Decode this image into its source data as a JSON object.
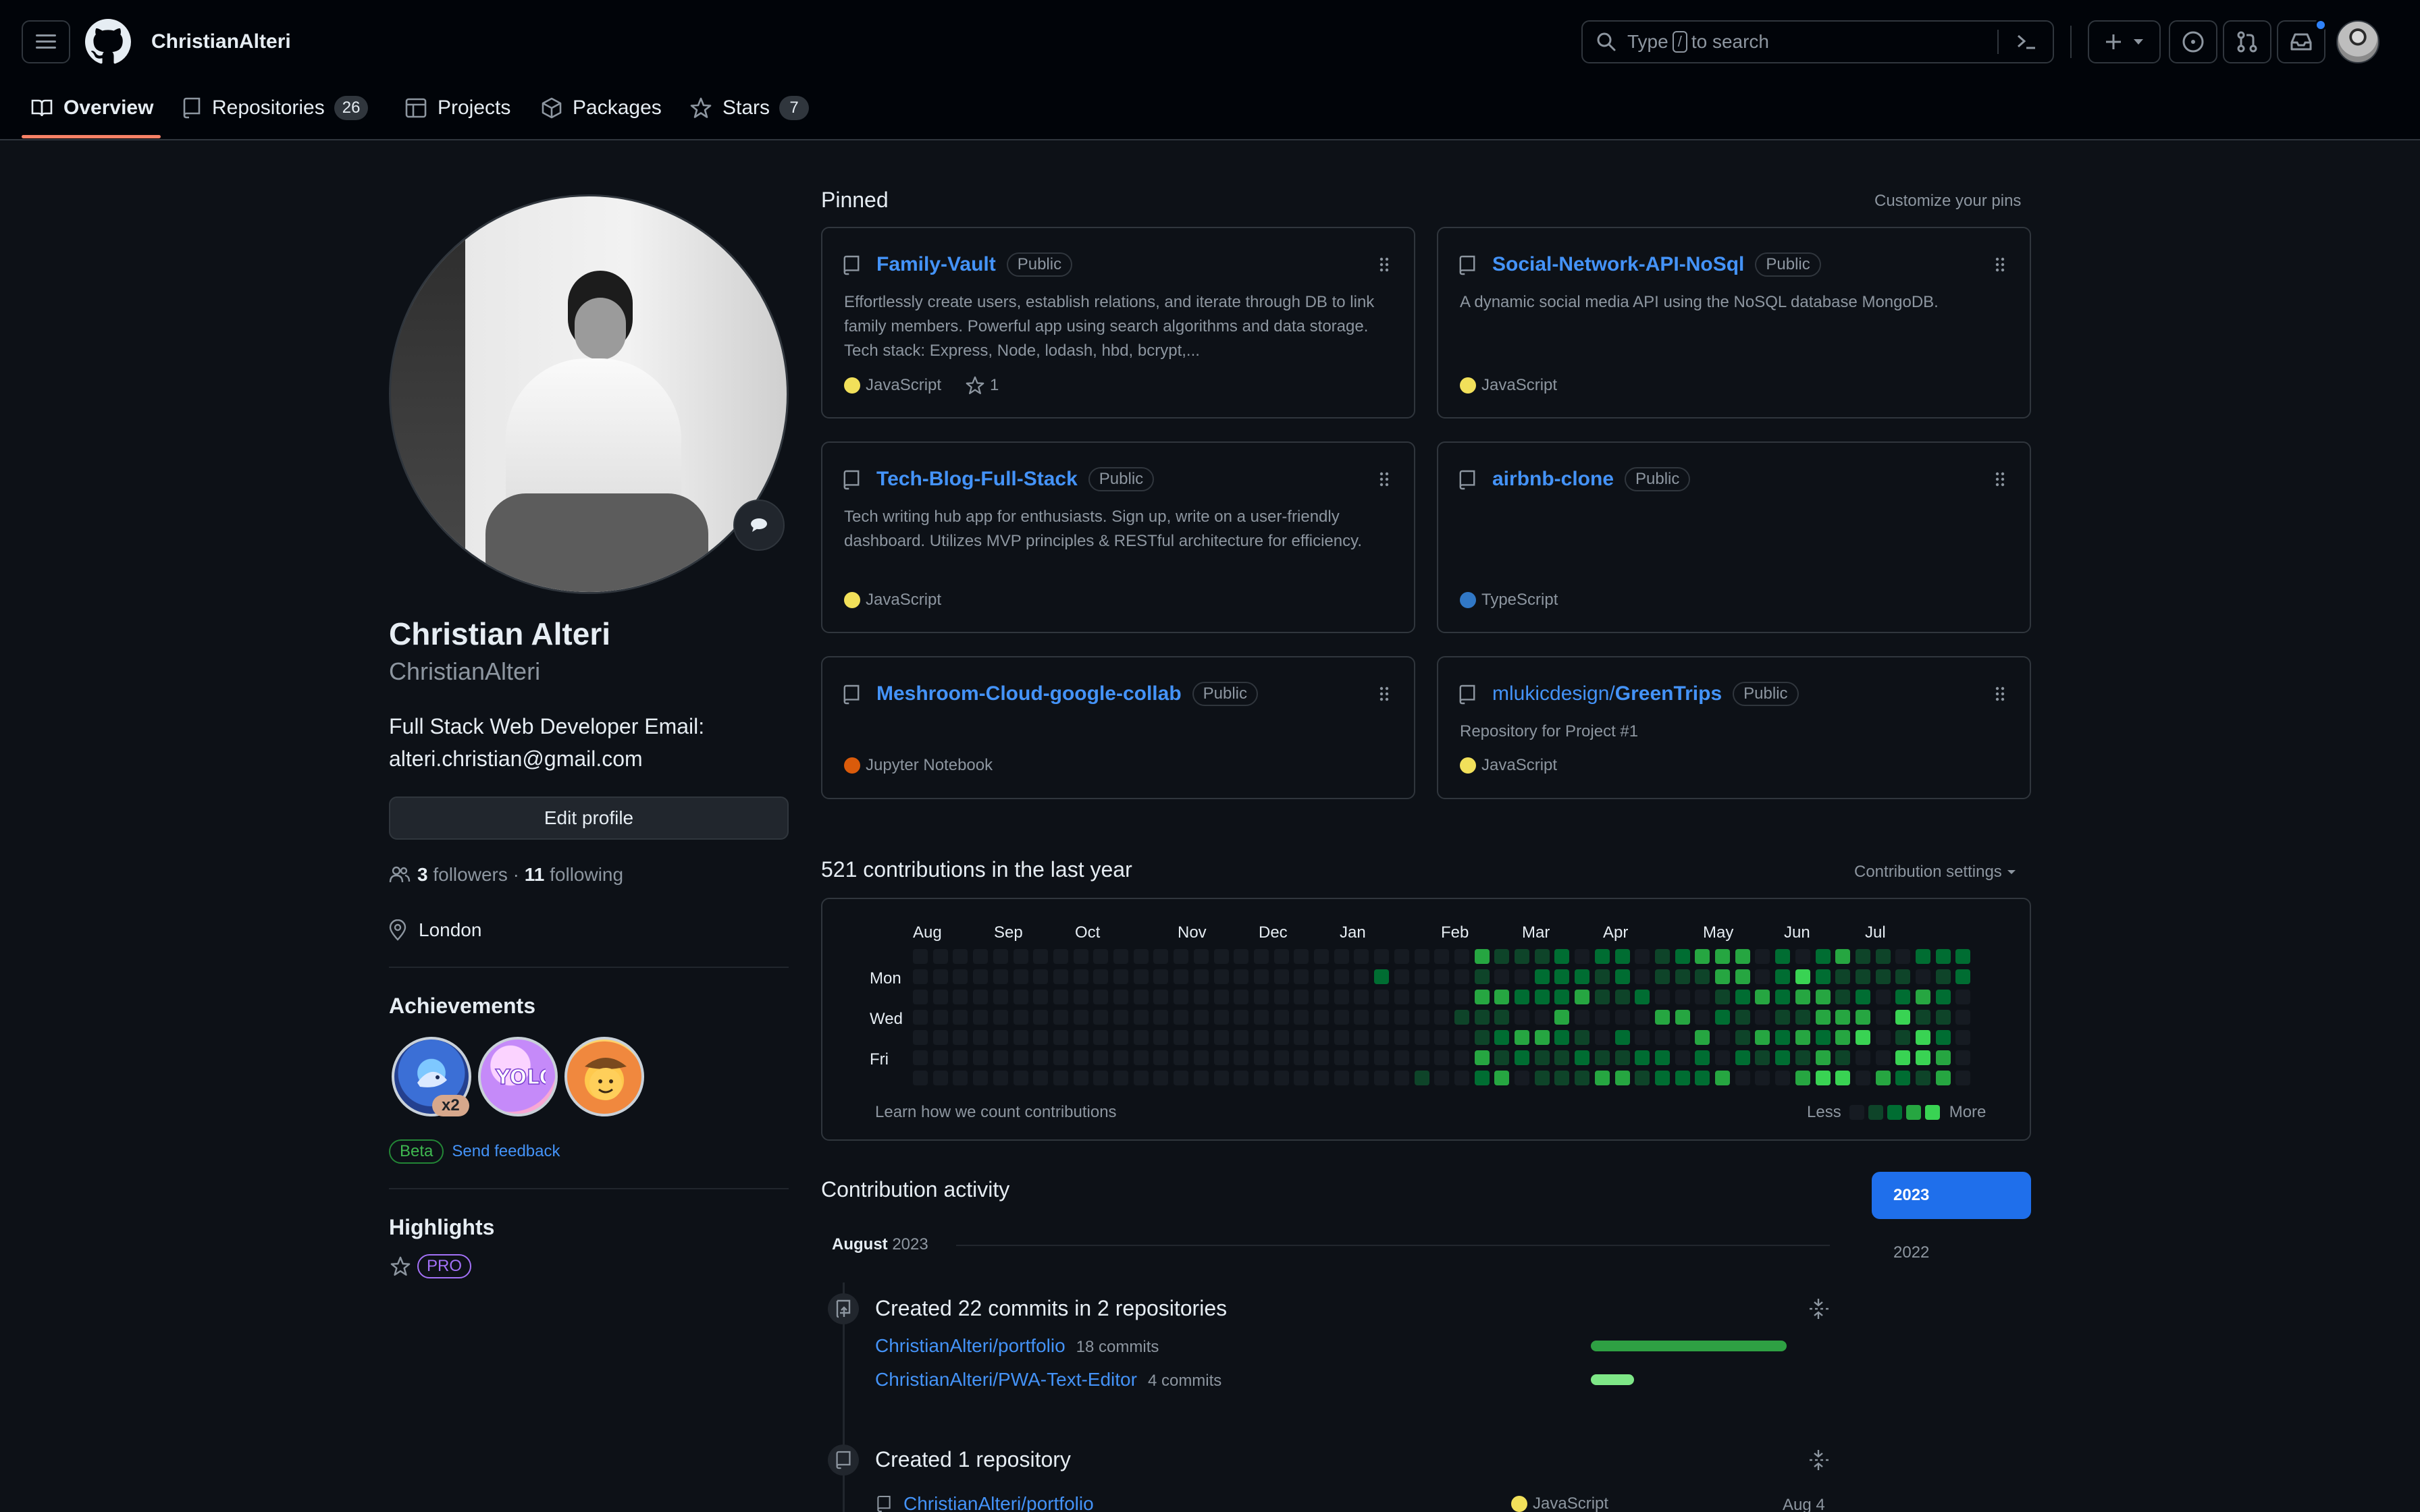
{
  "header": {
    "username": "ChristianAlteri",
    "search_prefix": "Type",
    "search_key": "/",
    "search_suffix": "to search"
  },
  "tabs": [
    {
      "label": "Overview"
    },
    {
      "label": "Repositories",
      "count": "26"
    },
    {
      "label": "Projects"
    },
    {
      "label": "Packages"
    },
    {
      "label": "Stars",
      "count": "7"
    }
  ],
  "profile": {
    "name": "Christian Alteri",
    "login": "ChristianAlteri",
    "bio": "Full Stack Web Developer Email: alteri.christian@gmail.com",
    "edit_label": "Edit profile",
    "followers_count": "3",
    "followers_label": "followers",
    "separator": "·",
    "following_count": "11",
    "following_label": "following",
    "location": "London",
    "achievements_title": "Achievements",
    "achievement_multiplier": "x2",
    "beta_label": "Beta",
    "feedback_label": "Send feedback",
    "highlights_title": "Highlights",
    "pro_label": "PRO"
  },
  "pinned": {
    "title": "Pinned",
    "customize": "Customize your pins",
    "cards": [
      {
        "name": "Family-Vault",
        "visibility": "Public",
        "description": "Effortlessly create users, establish relations, and iterate through DB to link family members. Powerful app using search algorithms and data storage. Tech stack: Express, Node, lodash, hbd, bcrypt,...",
        "language": "JavaScript",
        "lang_color": "#f1e05a",
        "stars": "1"
      },
      {
        "name": "Social-Network-API-NoSql",
        "visibility": "Public",
        "description": "A dynamic social media API using the NoSQL database MongoDB.",
        "language": "JavaScript",
        "lang_color": "#f1e05a"
      },
      {
        "name": "Tech-Blog-Full-Stack",
        "visibility": "Public",
        "description": "Tech writing hub app for enthusiasts. Sign up, write on a user-friendly dashboard. Utilizes MVP principles & RESTful architecture for efficiency.",
        "language": "JavaScript",
        "lang_color": "#f1e05a"
      },
      {
        "name": "airbnb-clone",
        "visibility": "Public",
        "description": "",
        "language": "TypeScript",
        "lang_color": "#3178c6"
      },
      {
        "name": "Meshroom-Cloud-google-collab",
        "visibility": "Public",
        "description": "",
        "language": "Jupyter Notebook",
        "lang_color": "#da5b0b"
      },
      {
        "owner": "mlukicdesign/",
        "name": "GreenTrips",
        "visibility": "Public",
        "description": "Repository for Project #1",
        "language": "JavaScript",
        "lang_color": "#f1e05a"
      }
    ]
  },
  "contributions": {
    "title": "521 contributions in the last year",
    "settings": "Contribution settings",
    "months": [
      "Aug",
      "Sep",
      "Oct",
      "Nov",
      "Dec",
      "Jan",
      "Feb",
      "Mar",
      "Apr",
      "May",
      "Jun",
      "Jul"
    ],
    "days": [
      "Mon",
      "Wed",
      "Fri"
    ],
    "learn": "Learn how we count contributions",
    "less": "Less",
    "more": "More",
    "levels": [
      "#161b22",
      "#0e4429",
      "#006d32",
      "#26a641",
      "#39d353"
    ]
  },
  "activity": {
    "title": "Contribution activity",
    "years": [
      "2023",
      "2022"
    ],
    "period_month": "August",
    "period_year": "2023",
    "commits_title": "Created 22 commits in 2 repositories",
    "repos": [
      {
        "name": "ChristianAlteri/portfolio",
        "commits": "18 commits",
        "ratio": 0.8182
      },
      {
        "name": "ChristianAlteri/PWA-Text-Editor",
        "commits": "4 commits",
        "ratio": 0.1818
      }
    ],
    "created_title": "Created 1 repository",
    "created_repo": "ChristianAlteri/portfolio",
    "created_lang": "JavaScript",
    "created_date": "Aug 4"
  }
}
